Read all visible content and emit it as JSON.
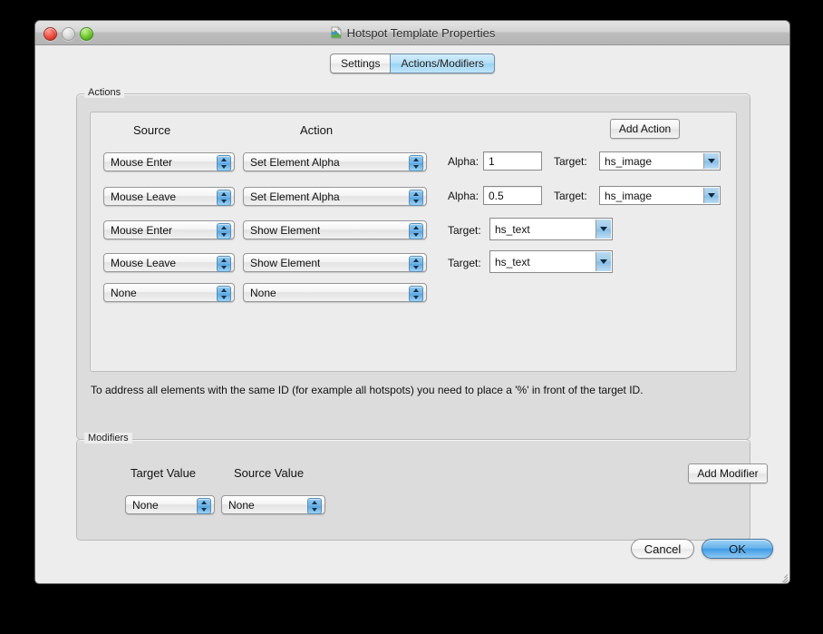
{
  "window": {
    "title": "Hotspot Template Properties",
    "title_icon": "app-document-icon",
    "traffic_lights": {
      "close": "close-button",
      "minimize": "minimize-button",
      "zoom": "zoom-button"
    }
  },
  "tabs": [
    {
      "label": "Settings",
      "active": false
    },
    {
      "label": "Actions/Modifiers",
      "active": true
    }
  ],
  "actions": {
    "group_label": "Actions",
    "columns": {
      "source": "Source",
      "action": "Action"
    },
    "add_button": "Add Action",
    "hint": "To address all elements with the same ID (for example all hotspots) you need to place a '%' in front of the target ID.",
    "alpha_label": "Alpha:",
    "target_label": "Target:",
    "rows": [
      {
        "source": "Mouse Enter",
        "action": "Set Element Alpha",
        "alpha": "1",
        "target": "hs_image"
      },
      {
        "source": "Mouse Leave",
        "action": "Set Element Alpha",
        "alpha": "0.5",
        "target": "hs_image"
      },
      {
        "source": "Mouse Enter",
        "action": "Show Element",
        "alpha": null,
        "target": "hs_text"
      },
      {
        "source": "Mouse Leave",
        "action": "Show Element",
        "alpha": null,
        "target": "hs_text"
      },
      {
        "source": "None",
        "action": "None",
        "alpha": null,
        "target": null
      }
    ]
  },
  "modifiers": {
    "group_label": "Modifiers",
    "columns": {
      "target_value": "Target Value",
      "source_value": "Source Value"
    },
    "add_button": "Add Modifier",
    "rows": [
      {
        "target_value": "None",
        "source_value": "None"
      }
    ]
  },
  "footer": {
    "cancel": "Cancel",
    "ok": "OK"
  },
  "colors": {
    "accent_blue": "#6fb3e6",
    "active_tab": "#9ad3f4",
    "window_bg": "#ededed",
    "group_bg": "#dcdcdc"
  }
}
